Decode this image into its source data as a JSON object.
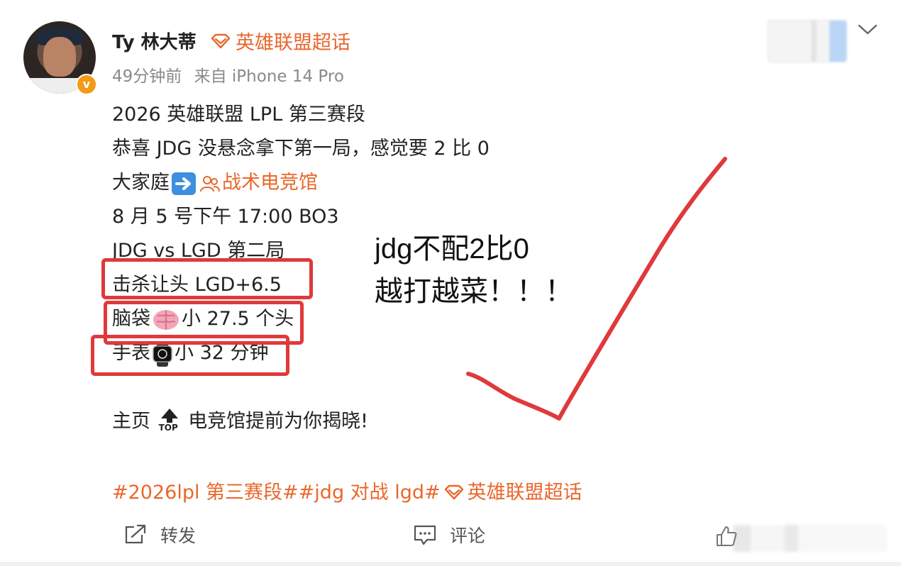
{
  "post": {
    "username": "Ty 林大蒂",
    "supertopic": "英雄联盟超话",
    "time": "49分钟前",
    "source": "来自 iPhone 14 Pro",
    "lines": [
      "2026 英雄联盟 LPL 第三赛段",
      "恭喜 JDG 没悬念拿下第一局，感觉要 2 比 0",
      "8 月 5 号下午 17:00 BO3",
      "JDG vs LGD 第二局",
      "击杀让头 LGD+6.5"
    ],
    "line_bigfamily_prefix": "大家庭",
    "line_bigfamily_link": "战术电竞馆",
    "line_brain_prefix": "脑袋",
    "line_brain_suffix": "小 27.5 个头",
    "line_watch_prefix": "手表",
    "line_watch_suffix": "小 32 分钟",
    "line_home_prefix": "主页",
    "line_home_suffix": "电竞馆提前为你揭晓!",
    "top_label": "TOP",
    "tags_text": "#2026lpl 第三赛段##jdg 对战 lgd#",
    "tags_supertopic": "英雄联盟超话"
  },
  "annotation": {
    "line1": "jdg不配2比0",
    "line2": "越打越菜！！！"
  },
  "actions": {
    "repost": "转发",
    "comment": "评论"
  },
  "icons": {
    "verified": "verified-v-icon",
    "supertopic": "diamond-icon",
    "arrow": "right-arrow-emoji",
    "group": "group-people-icon",
    "brain": "brain-emoji",
    "watch": "watch-emoji",
    "top": "top-arrow-emoji",
    "repost": "share-icon",
    "comment": "comment-icon",
    "like": "thumbs-up-icon",
    "more": "chevron-down-icon"
  },
  "colors": {
    "accent": "#e9672c",
    "annotation_red": "#e0393b",
    "meta_gray": "#8a8a8a"
  }
}
